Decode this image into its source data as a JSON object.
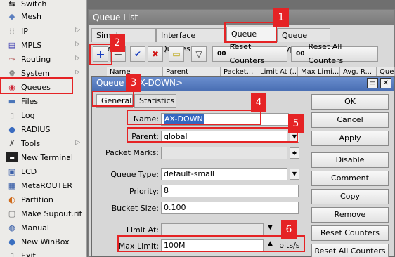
{
  "sidebar": {
    "items": [
      {
        "label": "Switch",
        "icon": "switch-icon",
        "arrow": false
      },
      {
        "label": "Mesh",
        "icon": "mesh-icon",
        "arrow": false
      },
      {
        "label": "IP",
        "icon": "ip-icon",
        "arrow": true
      },
      {
        "label": "MPLS",
        "icon": "mpls-icon",
        "arrow": true
      },
      {
        "label": "Routing",
        "icon": "routing-icon",
        "arrow": true
      },
      {
        "label": "System",
        "icon": "gear-icon",
        "arrow": true
      },
      {
        "label": "Queues",
        "icon": "queues-icon",
        "arrow": false
      },
      {
        "label": "Files",
        "icon": "files-icon",
        "arrow": false
      },
      {
        "label": "Log",
        "icon": "log-icon",
        "arrow": false
      },
      {
        "label": "RADIUS",
        "icon": "radius-icon",
        "arrow": false
      },
      {
        "label": "Tools",
        "icon": "tools-icon",
        "arrow": true
      },
      {
        "label": "New Terminal",
        "icon": "terminal-icon",
        "arrow": false
      },
      {
        "label": "LCD",
        "icon": "lcd-icon",
        "arrow": false
      },
      {
        "label": "MetaROUTER",
        "icon": "metarouter-icon",
        "arrow": false
      },
      {
        "label": "Partition",
        "icon": "partition-icon",
        "arrow": false
      },
      {
        "label": "Make Supout.rif",
        "icon": "supout-icon",
        "arrow": false
      },
      {
        "label": "Manual",
        "icon": "manual-icon",
        "arrow": false
      },
      {
        "label": "New WinBox",
        "icon": "winbox-icon",
        "arrow": false
      },
      {
        "label": "Exit",
        "icon": "exit-icon",
        "arrow": false
      }
    ]
  },
  "queue_list": {
    "title": "Queue List",
    "tabs": [
      "Simple Queues",
      "Interface Queues",
      "Queue Tree",
      "Queue Types"
    ],
    "active_tab": "Queue Tree",
    "toolbar": {
      "reset_counters": "Reset Counters",
      "reset_all_counters": "Reset All Counters"
    },
    "columns": [
      "Name",
      "Parent",
      "Packet...",
      "Limit At (...",
      "Max Limi...",
      "Avg. R...",
      "Queue"
    ]
  },
  "queue_dialog": {
    "title": "Queue <AX-DOWN>",
    "tabs": [
      "General",
      "Statistics"
    ],
    "fields": {
      "name_label": "Name:",
      "name_value": "AX-DOWN",
      "parent_label": "Parent:",
      "parent_value": "global",
      "packet_marks_label": "Packet Marks:",
      "queue_type_label": "Queue Type:",
      "queue_type_value": "default-small",
      "priority_label": "Priority:",
      "priority_value": "8",
      "bucket_size_label": "Bucket Size:",
      "bucket_size_value": "0.100",
      "limit_at_label": "Limit At:",
      "max_limit_label": "Max Limit:",
      "max_limit_value": "100M",
      "unit": "bits/s"
    },
    "buttons": [
      "OK",
      "Cancel",
      "Apply",
      "Disable",
      "Comment",
      "Copy",
      "Remove",
      "Reset Counters",
      "Reset All Counters"
    ]
  },
  "annotations": [
    "1",
    "2",
    "3",
    "4",
    "5",
    "6"
  ],
  "colors": {
    "annotation": "#e52325",
    "title_bar": "#4a6fb4",
    "selection": "#3468c0"
  }
}
